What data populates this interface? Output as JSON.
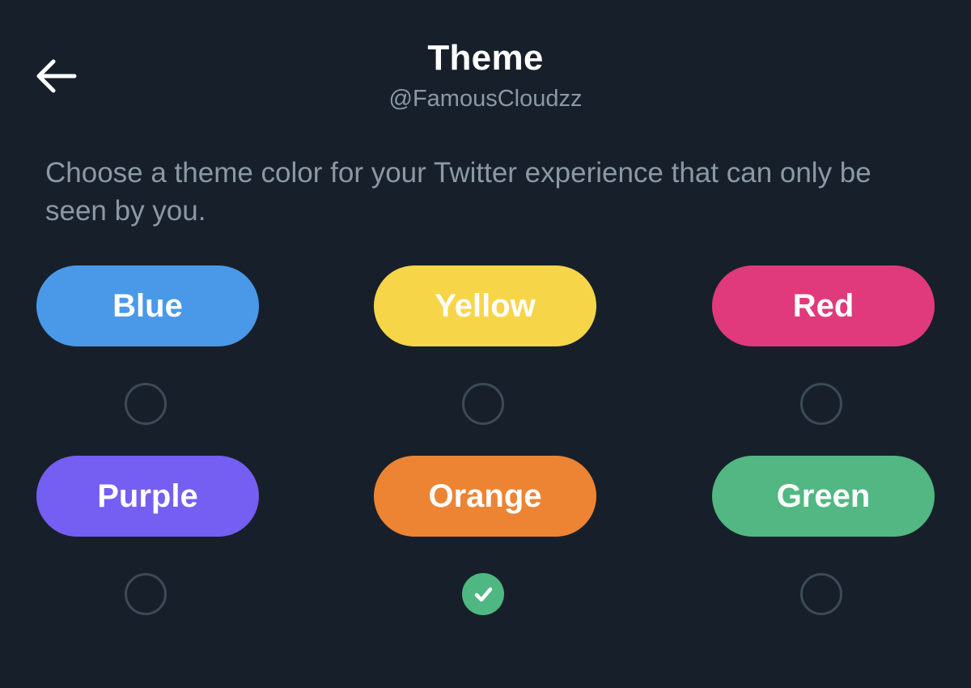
{
  "header": {
    "back_icon": "arrow-left-icon",
    "title": "Theme",
    "handle": "@FamousCloudzz"
  },
  "description": "Choose a theme color for your Twitter experience that can only be seen by you.",
  "colors": {
    "background": "#17202a",
    "muted_text": "#8b98a5",
    "radio_border": "#3d4a57",
    "checked": "#4fb782"
  },
  "themes": [
    {
      "label": "Blue",
      "color": "#4a99e9",
      "selected": false
    },
    {
      "label": "Yellow",
      "color": "#f7d548",
      "selected": false
    },
    {
      "label": "Red",
      "color": "#e03a7c",
      "selected": false
    },
    {
      "label": "Purple",
      "color": "#755ef2",
      "selected": false
    },
    {
      "label": "Orange",
      "color": "#ed8434",
      "selected": true
    },
    {
      "label": "Green",
      "color": "#52b782",
      "selected": false
    }
  ],
  "check_icon": "checkmark-icon"
}
